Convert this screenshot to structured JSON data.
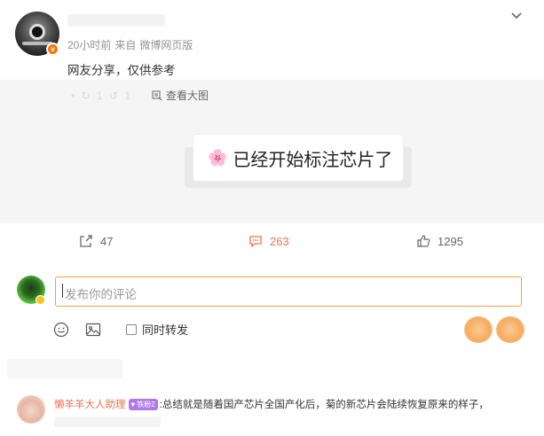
{
  "post": {
    "meta_time": "20小时前",
    "meta_from": "来自",
    "meta_source": "微博网页版",
    "text": "网友分享，仅供参考",
    "view_big_label": "查看大图",
    "faint_tools": "• ↻ 1 ↺ 1",
    "banner_emoji": "🌸",
    "banner_text": "已经开始标注芯片了"
  },
  "actions": {
    "share_count": "47",
    "comment_count": "263",
    "like_count": "1295"
  },
  "compose": {
    "placeholder": "发布你的评论",
    "repost_label": "同时转发"
  },
  "reply": {
    "name": "懒羊羊大人助理",
    "badge": "铁粉2",
    "text": ":总结就是随着国产芯片全国产化后，菊的新芯片会陆续恢复原来的样子，"
  },
  "colors": {
    "accent": "#eb7350",
    "input_border": "#f0a33c",
    "vip_badge": "#f0780f",
    "fan_badge": "#b07ae6"
  }
}
